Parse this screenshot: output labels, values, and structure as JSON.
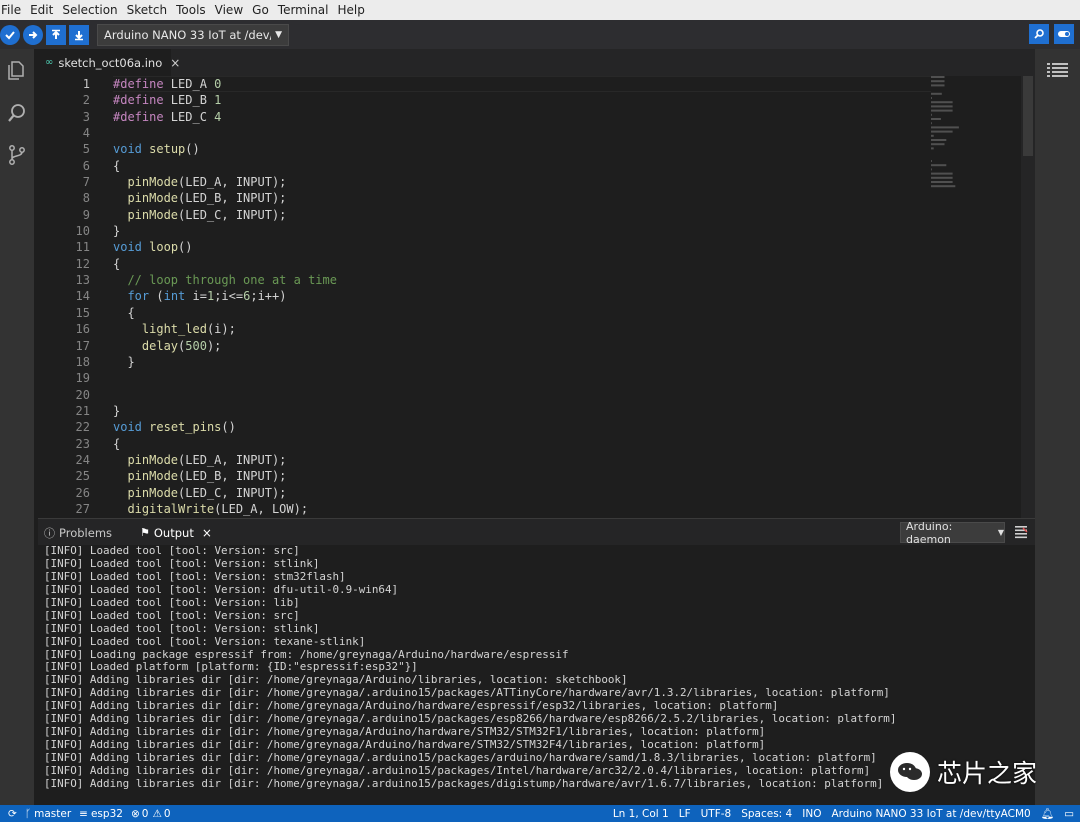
{
  "menu": [
    "File",
    "Edit",
    "Selection",
    "Sketch",
    "Tools",
    "View",
    "Go",
    "Terminal",
    "Help"
  ],
  "toolbar": {
    "board_select": "Arduino NANO 33 IoT at /dev/tt…",
    "verify_icon": "check-icon",
    "upload_icon": "arrow-right-icon"
  },
  "editor": {
    "tab_label": "sketch_oct06a.ino",
    "tab_icon": "infinity-icon",
    "line_numbers": [
      "1",
      "2",
      "3",
      "4",
      "5",
      "6",
      "7",
      "8",
      "9",
      "10",
      "11",
      "12",
      "13",
      "14",
      "15",
      "16",
      "17",
      "18",
      "19",
      "20",
      "21",
      "22",
      "23",
      "24",
      "25",
      "26",
      "27"
    ]
  },
  "panel": {
    "tab_problems": "Problems",
    "tab_output": "Output",
    "output_channel": "Arduino: daemon",
    "output_lines": [
      "[INFO] Loaded tool [tool: Version: src]",
      "[INFO] Loaded tool [tool: Version: stlink]",
      "[INFO] Loaded tool [tool: Version: stm32flash]",
      "[INFO] Loaded tool [tool: Version: dfu-util-0.9-win64]",
      "[INFO] Loaded tool [tool: Version: lib]",
      "[INFO] Loaded tool [tool: Version: src]",
      "[INFO] Loaded tool [tool: Version: stlink]",
      "[INFO] Loaded tool [tool: Version: texane-stlink]",
      "[INFO] Loading package espressif from: /home/greynaga/Arduino/hardware/espressif",
      "[INFO] Loaded platform [platform: {ID:\"espressif:esp32\"}]",
      "[INFO] Adding libraries dir [dir: /home/greynaga/Arduino/libraries, location: sketchbook]",
      "[INFO] Adding libraries dir [dir: /home/greynaga/.arduino15/packages/ATTinyCore/hardware/avr/1.3.2/libraries, location: platform]",
      "[INFO] Adding libraries dir [dir: /home/greynaga/Arduino/hardware/espressif/esp32/libraries, location: platform]",
      "[INFO] Adding libraries dir [dir: /home/greynaga/.arduino15/packages/esp8266/hardware/esp8266/2.5.2/libraries, location: platform]",
      "[INFO] Adding libraries dir [dir: /home/greynaga/Arduino/hardware/STM32/STM32F1/libraries, location: platform]",
      "[INFO] Adding libraries dir [dir: /home/greynaga/Arduino/hardware/STM32/STM32F4/libraries, location: platform]",
      "[INFO] Adding libraries dir [dir: /home/greynaga/.arduino15/packages/arduino/hardware/samd/1.8.3/libraries, location: platform]",
      "[INFO] Adding libraries dir [dir: /home/greynaga/.arduino15/packages/Intel/hardware/arc32/2.0.4/libraries, location: platform]",
      "[INFO] Adding libraries dir [dir: /home/greynaga/.arduino15/packages/digistump/hardware/avr/1.6.7/libraries, location: platform]"
    ]
  },
  "status": {
    "branch": "master",
    "project": "esp32",
    "errors": "0",
    "warnings": "0",
    "position": "Ln 1, Col 1",
    "eol": "LF",
    "encoding": "UTF-8",
    "spaces": "Spaces: 4",
    "language": "INO",
    "board": "Arduino NANO 33 IoT at /dev/ttyACM0"
  },
  "watermark": {
    "text": "芯片之家"
  },
  "colors": {
    "accent": "#1f6fd1",
    "statusbar": "#0e63bd",
    "keyword": "#569cd6",
    "function": "#dcdcaa",
    "comment": "#6a9955",
    "preprocessor": "#c586c0"
  }
}
